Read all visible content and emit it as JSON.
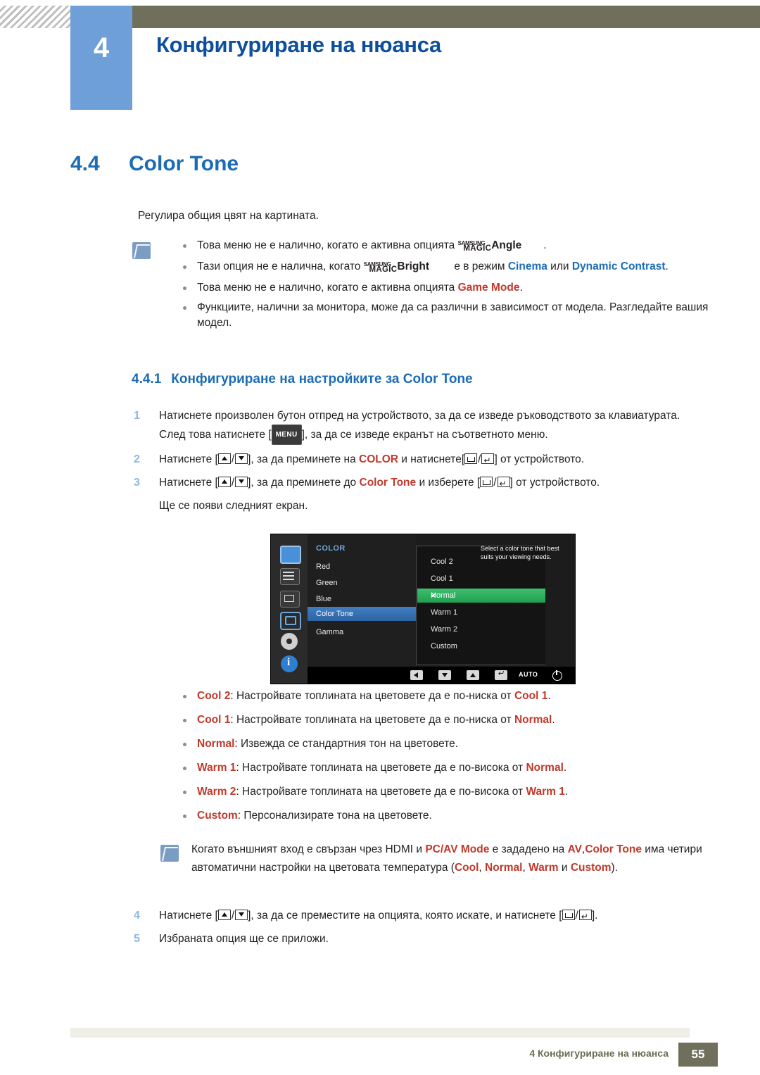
{
  "header": {
    "chapter_number": "4",
    "title": "Конфигуриране на нюанса"
  },
  "section": {
    "number": "4.4",
    "title": "Color Tone",
    "intro": "Регулира общия цвят на картината."
  },
  "notes_top": {
    "icon": "note-icon",
    "items": [
      {
        "pre": "Това меню не е налично, когато е активна опцията ",
        "magic_small": "SAMSUNG",
        "magic_big": "MAGIC",
        "magic_tail": "Angle",
        "post": "."
      },
      {
        "pre": "Тази опция не е налична, когато ",
        "magic_small": "SAMSUNG",
        "magic_big": "MAGIC",
        "magic_tail": "Bright",
        "mid": " е в режим ",
        "em1": "Cinema",
        "mid2": " или ",
        "em2": "Dynamic Contrast",
        "post": "."
      },
      {
        "pre": "Това меню не е налично, когато е активна опцията ",
        "em1": "Game Mode",
        "post": "."
      },
      {
        "pre": "Функциите, налични за монитора, може да са различни в зависимост от модела. Разгледайте вашия модел."
      }
    ]
  },
  "subsection": {
    "number": "4.4.1",
    "title": "Конфигуриране на настройките за Color Tone"
  },
  "steps": [
    {
      "num": "1",
      "t1": "Натиснете произволен бутон отпред на устройството, за да се изведе ръководството за клавиатурата. След това натиснете [",
      "key": "MENU",
      "t2": "], за да се изведе екранът на съответното меню."
    },
    {
      "num": "2",
      "t1": "Натиснете [",
      "t2": "], за да преминете на ",
      "em": "COLOR",
      "t3": " и натиснете[",
      "t4": "] от устройството."
    },
    {
      "num": "3",
      "t1": "Натиснете [",
      "t2": "], за да преминете до ",
      "em": "Color Tone",
      "t3": " и изберете [",
      "t4": "] от устройството.",
      "t5": "Ще се появи следният екран."
    }
  ],
  "osd": {
    "menu_title": "COLOR",
    "menu_items": [
      "Red",
      "Green",
      "Blue",
      "Color Tone",
      "Gamma"
    ],
    "menu_selected": "Color Tone",
    "sub_items": [
      "Cool 2",
      "Cool 1",
      "Normal",
      "Warm 1",
      "Warm 2",
      "Custom"
    ],
    "sub_selected": "Normal",
    "check_glyph": "✔",
    "help_text": "Select a color tone that best suits your viewing needs.",
    "footer": {
      "auto_label": "AUTO",
      "buttons": [
        "left-arrow",
        "down-arrow",
        "up-arrow",
        "enter",
        "AUTO",
        "power"
      ]
    }
  },
  "options": [
    {
      "name": "Cool 2",
      "desc_pre": ": Настройвате топлината на цветовете да е по-ниска от ",
      "ref": "Cool 1",
      "desc_post": "."
    },
    {
      "name": "Cool 1",
      "desc_pre": ": Настройвате топлината на цветовете да е по-ниска от ",
      "ref": "Normal",
      "desc_post": "."
    },
    {
      "name": "Normal",
      "desc_pre": ": Извежда се стандартния тон на цветовете.",
      "ref": "",
      "desc_post": ""
    },
    {
      "name": "Warm 1",
      "desc_pre": ": Настройвате топлината на цветовете да е по-висока от ",
      "ref": "Normal",
      "desc_post": "."
    },
    {
      "name": "Warm 2",
      "desc_pre": ": Настройвате топлината на цветовете да е по-висока от ",
      "ref": "Warm 1",
      "desc_post": "."
    },
    {
      "name": "Custom",
      "desc_pre": ": Персонализирате тона на цветовете.",
      "ref": "",
      "desc_post": ""
    }
  ],
  "note_bottom": {
    "icon": "note-icon",
    "t1": "Когато външният вход е свързан чрез HDMI и ",
    "em1": "PC/AV Mode",
    "t2": " е зададено на ",
    "em2": "AV",
    "em3": "Color Tone",
    "t3": " има четири автоматични настройки на цветовата температура (",
    "em4": "Cool",
    "t4": ", ",
    "em5": "Normal",
    "t5": ", ",
    "em6": "Warm",
    "t6": " и ",
    "em7": "Custom",
    "t7": ")."
  },
  "steps2": [
    {
      "num": "4",
      "t1": "Натиснете [",
      "t2": "], за да се преместите на опцията, която искате, и натиснете [",
      "t3": "]."
    },
    {
      "num": "5",
      "t1": "Избраната опция ще се приложи."
    }
  ],
  "footer": {
    "text": "4 Конфигуриране на нюанса",
    "page": "55"
  },
  "colors": {
    "heading_blue": "#1b6cb5",
    "term_red": "#c0392b",
    "header_bar": "#6f6f5c",
    "chapter_box": "#6f9fd8"
  }
}
